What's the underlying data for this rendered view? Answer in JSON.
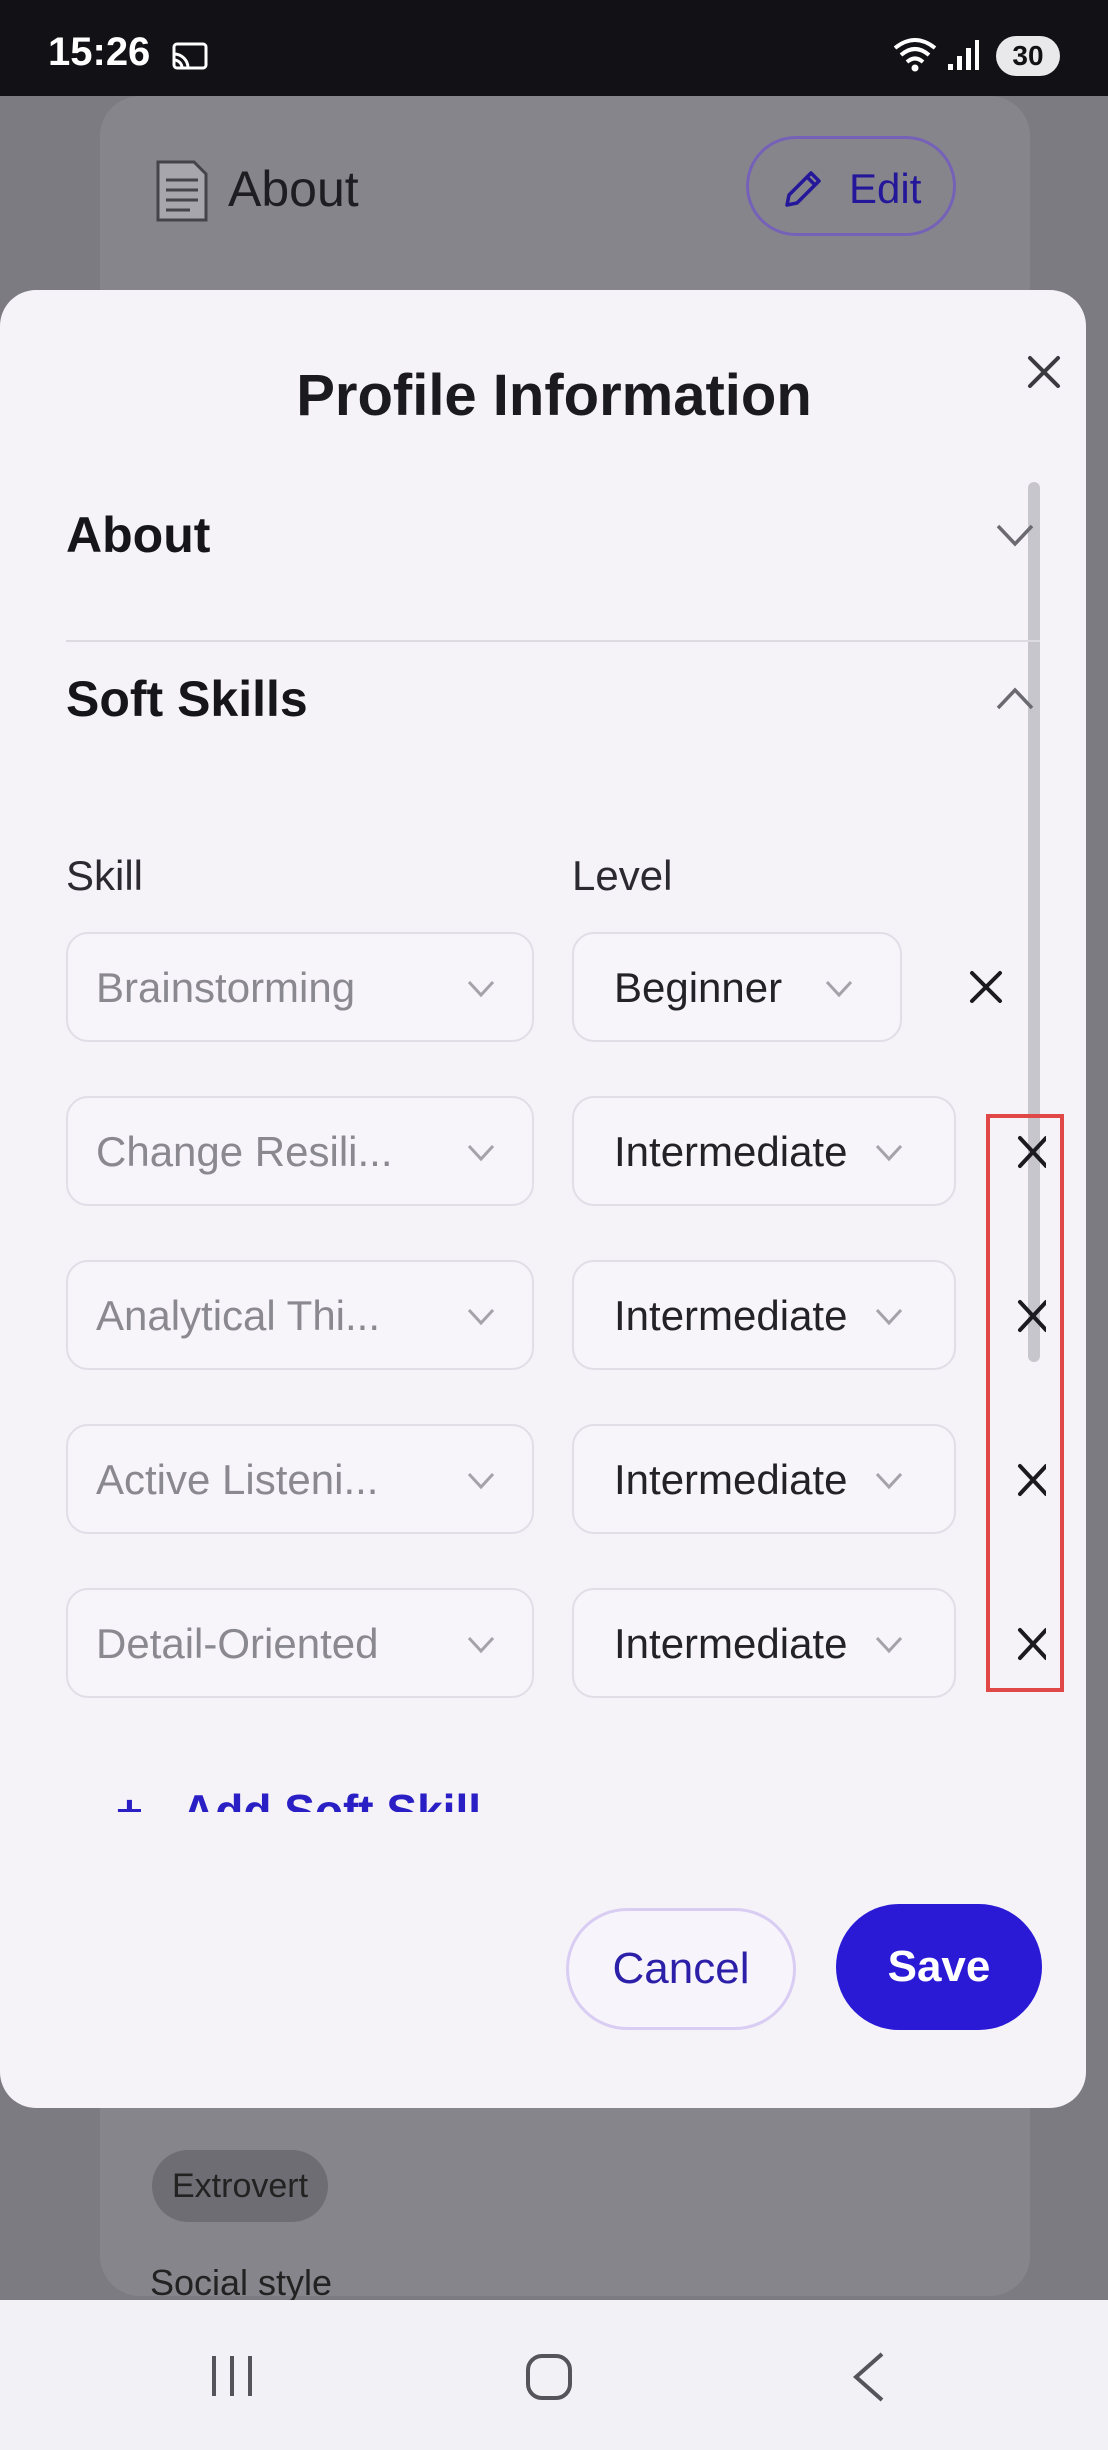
{
  "status_bar": {
    "time": "15:26",
    "battery": "30"
  },
  "background": {
    "section_title": "About",
    "edit_label": "Edit",
    "chip": "Extrovert",
    "social_label": "Social style"
  },
  "modal": {
    "title": "Profile Information",
    "sections": [
      {
        "title": "About",
        "expanded": false
      },
      {
        "title": "Soft Skills",
        "expanded": true
      }
    ],
    "columns": {
      "skill": "Skill",
      "level": "Level"
    },
    "rows": [
      {
        "skill": "Brainstorming",
        "level": "Beginner"
      },
      {
        "skill": "Change Resili...",
        "level": "Intermediate"
      },
      {
        "skill": "Analytical Thi...",
        "level": "Intermediate"
      },
      {
        "skill": "Active Listeni...",
        "level": "Intermediate"
      },
      {
        "skill": "Detail-Oriented",
        "level": "Intermediate"
      }
    ],
    "add_label": "Add Soft Skill",
    "cancel_label": "Cancel",
    "save_label": "Save"
  },
  "colors": {
    "accent": "#2a1ad6",
    "highlight": "#e04848"
  }
}
